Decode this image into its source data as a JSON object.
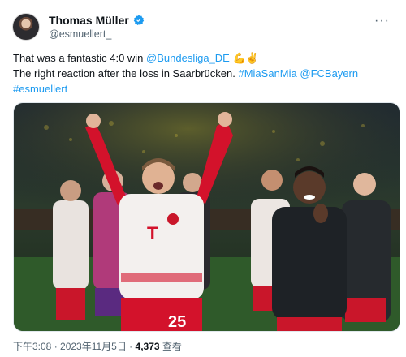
{
  "author": {
    "display_name": "Thomas Müller",
    "handle": "@esmuellert_",
    "verified_icon": "verified-badge-icon",
    "avatar_icon": "profile-avatar"
  },
  "more_icon": "more-options-icon",
  "tweet": {
    "line1_text": "That was a fantastic 4:0 win ",
    "line1_mention": "@Bundesliga_DE",
    "line1_emoji": "💪✌️",
    "line2_text": "The right reaction after the loss in Saarbrücken. ",
    "line2_hashtag": "#MiaSanMia",
    "line2_mention": "@FCBayern",
    "line3_hashtag": "#esmuellert"
  },
  "media": {
    "jersey_number": "25",
    "accent_colors": {
      "bayern_red": "#d3122b",
      "link_blue": "#1d9bf0"
    }
  },
  "meta": {
    "time_date": "下午3:08 · 2023年11月5日 · ",
    "views_count": "4,373",
    "views_label": " 查看"
  }
}
